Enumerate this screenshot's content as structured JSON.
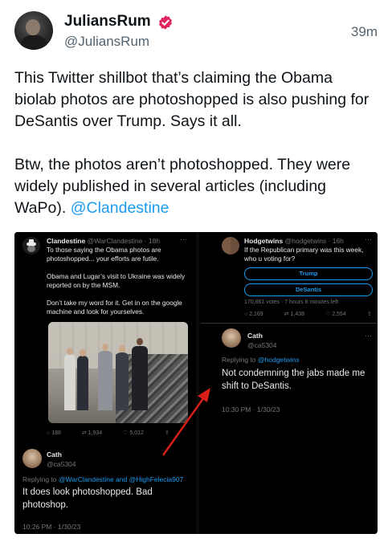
{
  "tweet": {
    "display_name": "JuliansRum",
    "handle": "@JuliansRum",
    "time": "39m",
    "paragraph1": "This Twitter shillbot that’s claiming the Obama biolab photos are photoshopped is also pushing for DeSantis over Trump. Says it all.",
    "paragraph2_prefix": "Btw, the photos aren’t photoshopped. They were widely published in several articles (including WaPo). ",
    "paragraph2_mention": "@Clandestine",
    "verified_icon": "verified-badge-icon",
    "colors": {
      "text": "#0f1419",
      "muted": "#536471",
      "link": "#1d9bf0",
      "verified": "#e0245e"
    }
  },
  "left_shot": {
    "author_name": "Clandestine",
    "author_meta": "@WarClandestine · 18h",
    "more": "···",
    "body1": "To those saying the Obama photos are photoshopped... your efforts are futile.",
    "body2": "Obama and Lugar’s visit to Ukraine was widely reported on by the MSM.",
    "body3": "Don’t take my word for it. Get in on the google machine and look for yourselves.",
    "stats": {
      "replies": "188",
      "retweets": "1,934",
      "likes": "5,012"
    },
    "reply_name": "Cath",
    "reply_handle": "@ca5304",
    "replying_prefix": "Replying to ",
    "replying_to": "@WarClandestine and @HighFelecia907",
    "reply_text": "It does look photoshopped. Bad photoshop.",
    "reply_time": "10:26 PM · 1/30/23"
  },
  "right_shot": {
    "author_name": "Hodgetwins",
    "author_meta": "@hodgetwins · 16h",
    "more": "···",
    "body": "If the Republican primary was this week, who u voting for?",
    "poll_options": [
      "Trump",
      "DeSantis"
    ],
    "poll_meta": "170,861 votes · 7 hours 8 minutes left",
    "stats": {
      "replies": "2,169",
      "retweets": "1,438",
      "likes": "2,554"
    },
    "reply_name": "Cath",
    "reply_handle": "@ca5304",
    "replying_prefix": "Replying to ",
    "replying_to": "@hodgetwins",
    "reply_text": "Not condemning the jabs made me shift to DeSantis.",
    "reply_time": "10:30 PM · 1/30/23"
  }
}
